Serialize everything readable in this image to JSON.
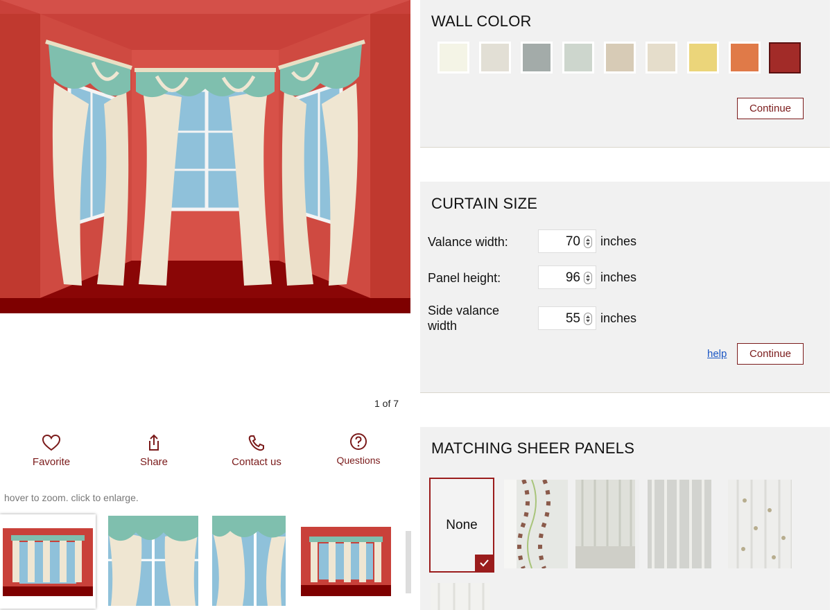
{
  "gallery": {
    "counter": "1 of 7",
    "hint": "hover to zoom. click to enlarge."
  },
  "actions": [
    {
      "label": "Favorite",
      "icon": "heart-icon"
    },
    {
      "label": "Share",
      "icon": "share-icon"
    },
    {
      "label": "Contact us",
      "icon": "phone-icon"
    },
    {
      "label": "Questions",
      "icon": "question-circle-icon"
    }
  ],
  "wall_color": {
    "title": "WALL COLOR",
    "swatches": [
      "#f4f4e6",
      "#e2dfd5",
      "#a3aba9",
      "#cdd6cd",
      "#d7cbb6",
      "#e5ddcb",
      "#ebd57a",
      "#e07a48",
      "#a22b28"
    ],
    "selected_index": 8,
    "continue_label": "Continue"
  },
  "curtain_size": {
    "title": "CURTAIN SIZE",
    "rows": [
      {
        "label": "Valance width:",
        "value": "70",
        "unit": "inches"
      },
      {
        "label": "Panel height:",
        "value": "96",
        "unit": "inches"
      },
      {
        "label": "Side valance width",
        "value": "55",
        "unit": "inches"
      }
    ],
    "help_label": "help",
    "continue_label": "Continue"
  },
  "sheer_panels": {
    "title": "MATCHING SHEER PANELS",
    "none_label": "None"
  },
  "colors": {
    "accent": "#7a1a1a",
    "wall": "#d1493f",
    "floor": "#7e0000",
    "valance": "#7fbfae",
    "panel": "#efe6d2",
    "window": "#8fc1da"
  }
}
